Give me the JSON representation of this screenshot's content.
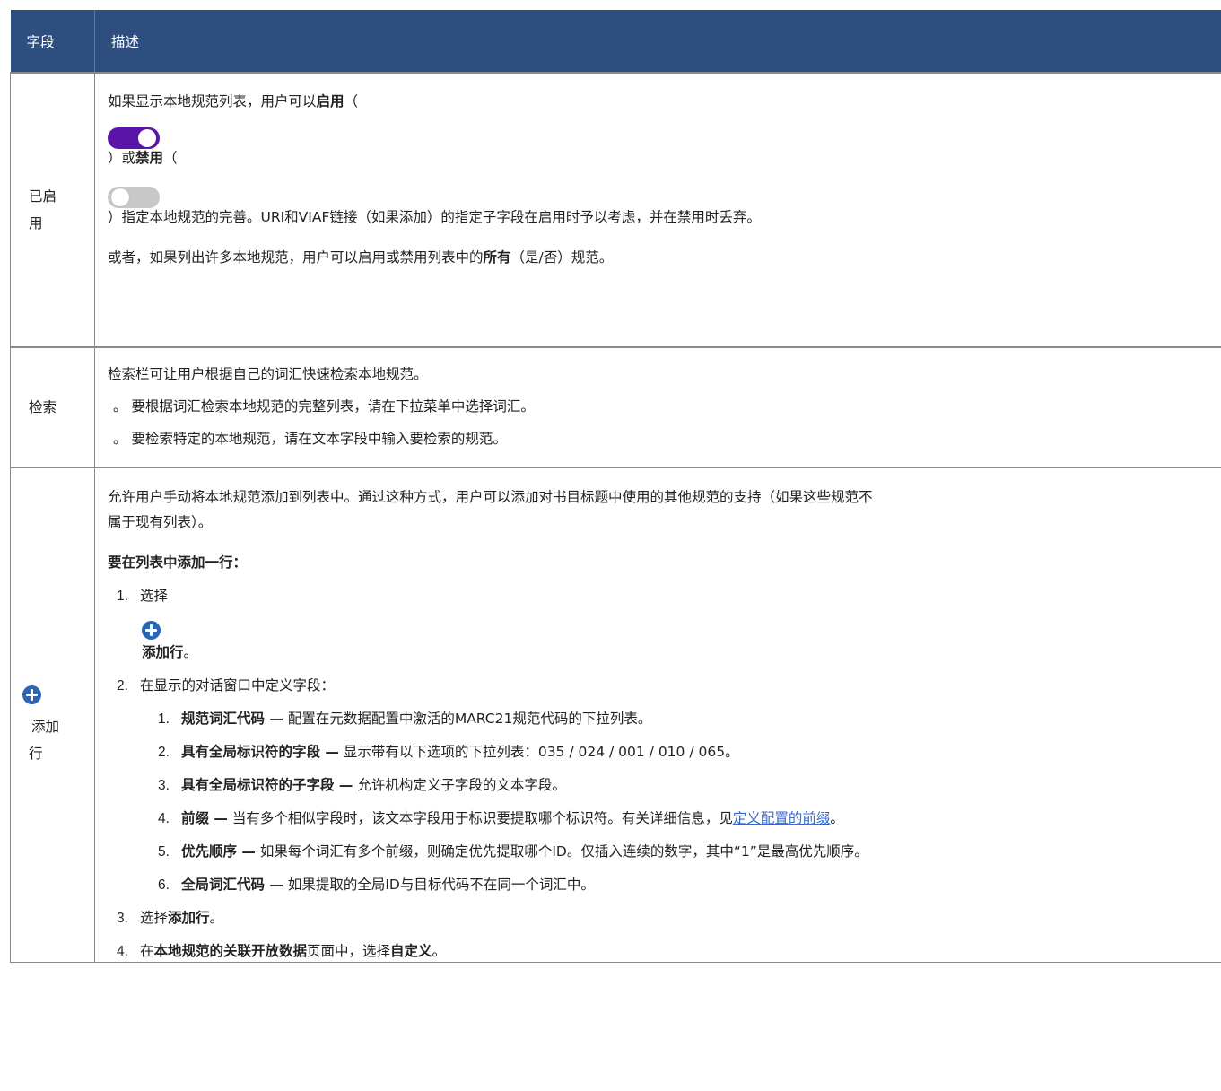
{
  "header": {
    "col_field": "字段",
    "col_desc": "描述"
  },
  "row_enabled": {
    "field_line1": "已启",
    "field_line2": "用",
    "p1": "如果显示本地规范列表，用户可以",
    "p1_bold": "启用",
    "p1_end": "（",
    "p2_start": "）或",
    "p2_bold": "禁用",
    "p2_end": "（",
    "p3": "）指定本地规范的完善。URI和VIAF链接（如果添加）的指定子字段在启用时予以考虑，并在禁用时丢弃。",
    "p4_start": "或者，如果列出许多本地规范，用户可以启用或禁用列表中的",
    "p4_bold": "所有",
    "p4_end": "（是/否）规范。",
    "toggle_on_state": "on",
    "toggle_off_state": "off",
    "toggle_on_color": "#5b14a8",
    "toggle_off_color": "#c8c8c8"
  },
  "row_search": {
    "field": "检索",
    "intro": "检索栏可让用户根据自己的词汇快速检索本地规范。",
    "bullet1": "。 要根据词汇检索本地规范的完整列表，请在下拉菜单中选择词汇。",
    "bullet2": "。 要检索特定的本地规范，请在文本字段中输入要检索的规范。"
  },
  "row_add": {
    "field_icon": "plus-circle-icon",
    "field_line1": "添加",
    "field_line2": "行",
    "intro_line1": "允许用户手动将本地规范添加到列表中。通过这种方式，用户可以添加对书目标题中使用的其他规范的支持（如果这些规范不",
    "intro_line2": "属于现有列表）。",
    "heading": "要在列表中添加一行：",
    "step1_num": "1.",
    "step1_text": "选择",
    "step1_icon": "plus-circle-icon",
    "step1_bold": "添加行",
    "step1_end": "。",
    "step2_num": "2.",
    "step2_text": "在显示的对话窗口中定义字段：",
    "sub": [
      {
        "num": "1.",
        "bold": "规范词汇代码 —",
        "text": " 配置在元数据配置中激活的MARC21规范代码的下拉列表。"
      },
      {
        "num": "2.",
        "bold": "具有全局标识符的字段 —",
        "text": " 显示带有以下选项的下拉列表：035 / 024 / 001 / 010 / 065。"
      },
      {
        "num": "3.",
        "bold": "具有全局标识符的子字段 —",
        "text": " 允许机构定义子字段的文本字段。"
      },
      {
        "num": "4.",
        "bold": "前缀 —",
        "text": " 当有多个相似字段时，该文本字段用于标识要提取哪个标识符。有关详细信息，见",
        "link": "定义配置的前缀",
        "end": "。"
      },
      {
        "num": "5.",
        "bold": "优先顺序 —",
        "text": " 如果每个词汇有多个前缀，则确定优先提取哪个ID。仅插入连续的数字，其中“1”是最高优先顺序。"
      },
      {
        "num": "6.",
        "bold": "全局词汇代码 —",
        "text": " 如果提取的全局ID与目标代码不在同一个词汇中。"
      }
    ],
    "step3_num": "3.",
    "step3_text": "选择",
    "step3_bold": "添加行",
    "step3_end": "。",
    "step4_num": "4.",
    "step4_text": "在",
    "step4_bold1": "本地规范的关联开放数据",
    "step4_mid": "页面中，选择",
    "step4_bold2": "自定义",
    "step4_end": "。"
  }
}
